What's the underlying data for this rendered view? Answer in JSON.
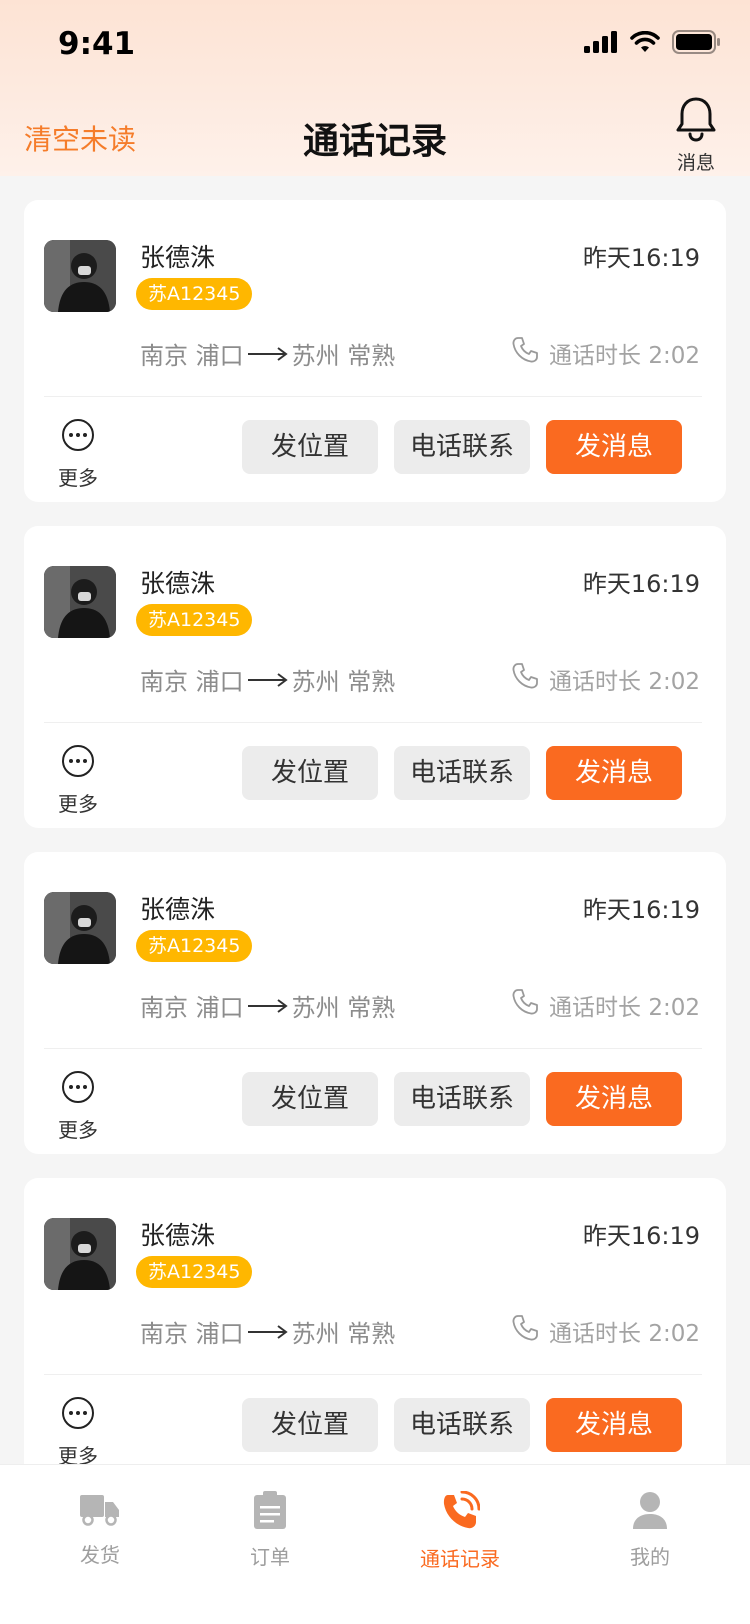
{
  "status": {
    "time": "9:41"
  },
  "nav": {
    "left_action": "清空未读",
    "title": "通话记录",
    "right_label": "消息"
  },
  "colors": {
    "accent": "#fa6a20",
    "plate": "#ffb700",
    "header_top": "#fde3d4"
  },
  "cards": [
    {
      "name": "张德洙",
      "time": "昨天16:19",
      "plate": "苏A12345",
      "from": "南京 浦口",
      "to": "苏州 常熟",
      "duration": "通话时长 2:02",
      "more": "更多",
      "btn_location": "发位置",
      "btn_call": "电话联系",
      "btn_message": "发消息"
    },
    {
      "name": "张德洙",
      "time": "昨天16:19",
      "plate": "苏A12345",
      "from": "南京 浦口",
      "to": "苏州 常熟",
      "duration": "通话时长 2:02",
      "more": "更多",
      "btn_location": "发位置",
      "btn_call": "电话联系",
      "btn_message": "发消息"
    },
    {
      "name": "张德洙",
      "time": "昨天16:19",
      "plate": "苏A12345",
      "from": "南京 浦口",
      "to": "苏州 常熟",
      "duration": "通话时长 2:02",
      "more": "更多",
      "btn_location": "发位置",
      "btn_call": "电话联系",
      "btn_message": "发消息"
    },
    {
      "name": "张德洙",
      "time": "昨天16:19",
      "plate": "苏A12345",
      "from": "南京 浦口",
      "to": "苏州 常熟",
      "duration": "通话时长 2:02",
      "more": "更多",
      "btn_location": "发位置",
      "btn_call": "电话联系",
      "btn_message": "发消息"
    }
  ],
  "tabs": [
    {
      "label": "发货",
      "icon": "truck-icon"
    },
    {
      "label": "订单",
      "icon": "clipboard-icon"
    },
    {
      "label": "通话记录",
      "icon": "phone-call-icon",
      "active": true
    },
    {
      "label": "我的",
      "icon": "user-icon"
    }
  ]
}
